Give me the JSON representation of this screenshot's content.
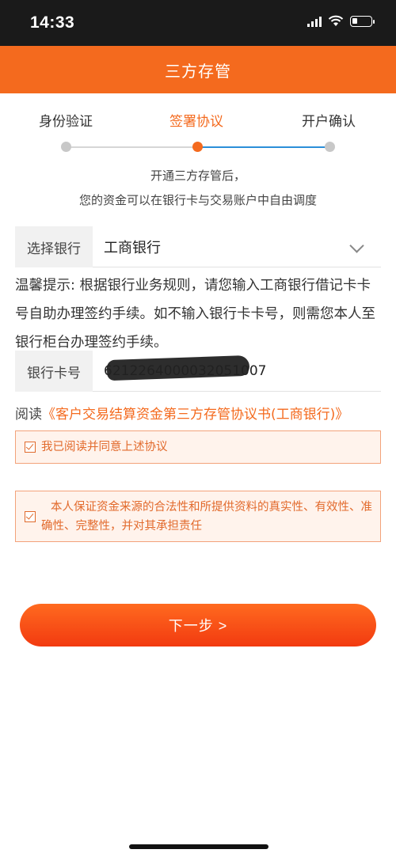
{
  "status": {
    "time": "14:33",
    "battery_level": 0.3
  },
  "header": {
    "title": "三方存管"
  },
  "steps": [
    {
      "label": "身份验证",
      "active": false
    },
    {
      "label": "签署协议",
      "active": true
    },
    {
      "label": "开户确认",
      "active": false
    }
  ],
  "intro": {
    "line1": "开通三方存管后，",
    "line2": "您的资金可以在银行卡与交易账户中自由调度"
  },
  "bank": {
    "label": "选择银行",
    "value": "工商银行"
  },
  "tip": {
    "text": "温馨提示: 根据银行业务规则，请您输入工商银行借记卡卡号自助办理签约手续。如不输入银行卡卡号，则需您本人至银行柜台办理签约手续。"
  },
  "card": {
    "label": "银行卡号",
    "value": "6212264000032051007"
  },
  "agreement": {
    "prefix": "阅读",
    "link": "《客户交易结算资金第三方存管协议书(工商银行)》"
  },
  "checkbox1": {
    "label": "我已阅读并同意上述协议",
    "checked": true
  },
  "checkbox2": {
    "label": "本人保证资金来源的合法性和所提供资料的真实性、有效性、准确性、完整性，并对其承担责任",
    "checked": true
  },
  "next_button": {
    "label": "下一步 >"
  },
  "colors": {
    "accent": "#f46a1e",
    "blue_line": "#2b8fd8"
  }
}
